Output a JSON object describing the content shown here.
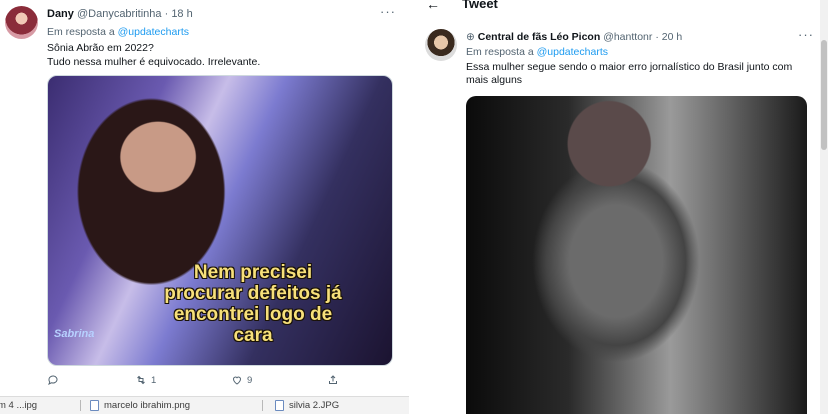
{
  "left_tweet": {
    "author_name": "Dany",
    "handle": "@Danycabritinha",
    "separator": "·",
    "time": "18 h",
    "more": "···",
    "reply_prefix": "Em resposta a",
    "reply_mention": "@updatecharts",
    "text_lines": [
      "Sônia Abrão em 2022?",
      "Tudo nessa mulher é equivocado. Irrelevante."
    ],
    "media": {
      "caption_lines": [
        "Nem precisei",
        "procurar defeitos já",
        "encontrei logo de",
        "cara"
      ],
      "brand": "Sabrina"
    },
    "actions": {
      "reply_count": "",
      "retweet_count": "1",
      "like_count": "9"
    }
  },
  "downloads": [
    {
      "name": "m 4 ...ipg"
    },
    {
      "name": "marcelo ibrahim.png"
    },
    {
      "name": "silvia 2.JPG"
    }
  ],
  "right_panel": {
    "title": "Tweet",
    "back_icon": "arrow-left-icon",
    "tweet": {
      "pin": "⊕",
      "author_name": "Central de fãs Léo Picon",
      "handle": "@hanttonr",
      "separator": "·",
      "time": "20 h",
      "more": "···",
      "reply_prefix": "Em resposta a",
      "reply_mention": "@updatecharts",
      "text": "Essa mulher segue sendo o maior erro jornalístico do Brasil junto com mais alguns"
    }
  },
  "colors": {
    "link": "#1d9bf0",
    "secondary_text": "#536471",
    "meme_caption": "#f7e07a"
  }
}
